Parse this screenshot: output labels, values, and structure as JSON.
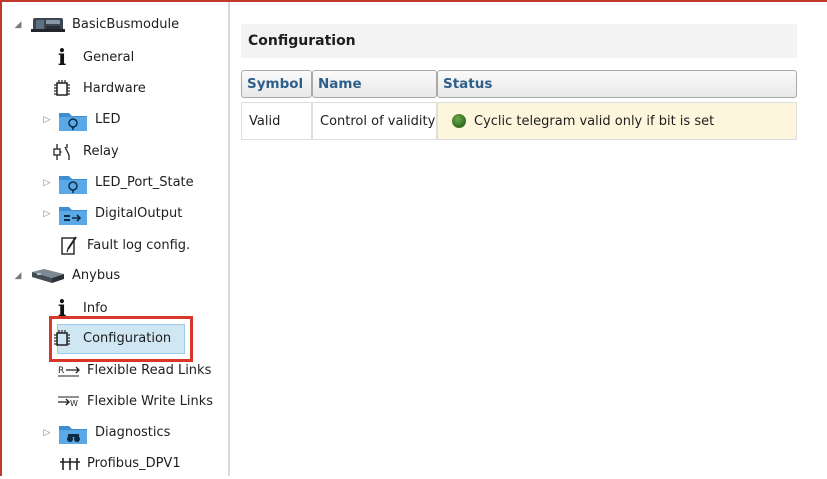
{
  "tree": {
    "items": [
      {
        "label": "BasicBusmodule",
        "icon": "module-icon",
        "expanded": true
      },
      {
        "label": "General",
        "icon": "info-icon"
      },
      {
        "label": "Hardware",
        "icon": "chip-icon"
      },
      {
        "label": "LED",
        "icon": "led-folder-icon",
        "collapsed": true
      },
      {
        "label": "Relay",
        "icon": "relay-icon"
      },
      {
        "label": "LED_Port_State",
        "icon": "led-folder-icon",
        "collapsed": true
      },
      {
        "label": "DigitalOutput",
        "icon": "digital-output-folder-icon",
        "collapsed": true
      },
      {
        "label": "Fault log config.",
        "icon": "fault-log-icon"
      },
      {
        "label": "Anybus",
        "icon": "anybus-icon",
        "expanded": true
      },
      {
        "label": "Info",
        "icon": "info-icon"
      },
      {
        "label": "Configuration",
        "icon": "chip-icon",
        "selected": true
      },
      {
        "label": "Flexible Read Links",
        "icon": "read-link-icon"
      },
      {
        "label": "Flexible Write Links",
        "icon": "write-link-icon"
      },
      {
        "label": "Diagnostics",
        "icon": "diagnostics-folder-icon",
        "collapsed": true
      },
      {
        "label": "Profibus_DPV1",
        "icon": "profibus-icon"
      }
    ]
  },
  "main": {
    "title": "Configuration",
    "columns": [
      "Symbol",
      "Name",
      "Status"
    ],
    "rows": [
      {
        "symbol": "Valid",
        "name": "Control of validity",
        "status": "Cyclic telegram valid only if bit is set",
        "status_color": "#3f7f2a"
      }
    ]
  },
  "colors": {
    "highlight_border": "#d9362a",
    "selection_fill": "#cfe6f3",
    "status_background": "#fdf6dc",
    "header_text": "#2e5f8a"
  }
}
